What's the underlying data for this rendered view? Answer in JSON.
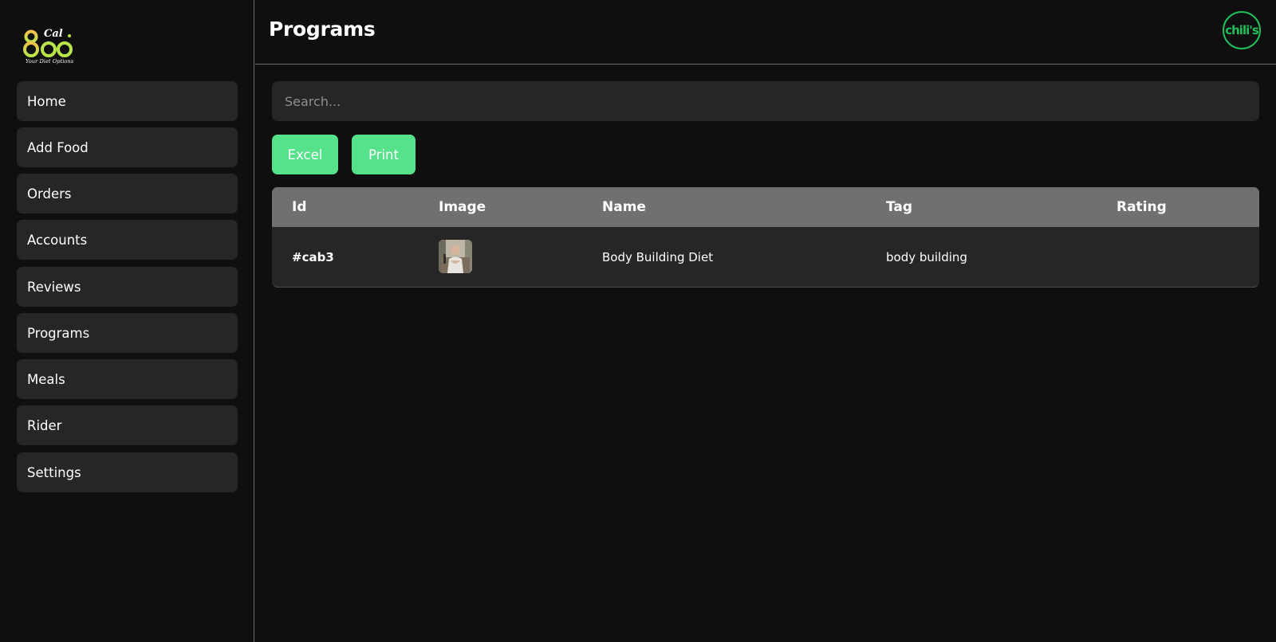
{
  "logo": {
    "number": "800",
    "cal": "Cal",
    "tagline": "Your Diet Options"
  },
  "sidebar": {
    "items": [
      {
        "label": "Home"
      },
      {
        "label": "Add Food"
      },
      {
        "label": "Orders"
      },
      {
        "label": "Accounts"
      },
      {
        "label": "Reviews"
      },
      {
        "label": "Programs"
      },
      {
        "label": "Meals"
      },
      {
        "label": "Rider"
      },
      {
        "label": "Settings"
      }
    ]
  },
  "header": {
    "title": "Programs",
    "brand_avatar_text": "chili's"
  },
  "search": {
    "placeholder": "Search...",
    "value": ""
  },
  "toolbar": {
    "excel_label": "Excel",
    "print_label": "Print",
    "accent_color": "#55e28b"
  },
  "table": {
    "columns": [
      "Id",
      "Image",
      "Name",
      "Tag",
      "Rating"
    ],
    "rows": [
      {
        "id": "#cab3",
        "image": "program-thumbnail",
        "name": "Body Building Diet",
        "tag": "body building",
        "rating": ""
      }
    ]
  }
}
